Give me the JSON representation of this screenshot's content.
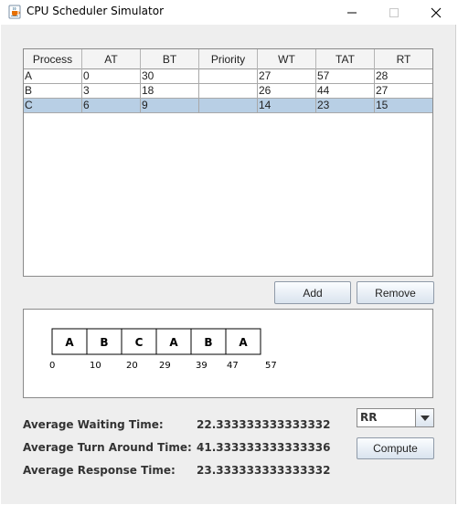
{
  "window": {
    "title": "CPU Scheduler Simulator",
    "icons": {
      "app": "java-coffee-cup-icon",
      "minimize": "minimize-icon",
      "maximize": "maximize-icon",
      "close": "close-icon"
    }
  },
  "table": {
    "columns": [
      "Process",
      "AT",
      "BT",
      "Priority",
      "WT",
      "TAT",
      "RT"
    ],
    "rows": [
      [
        "A",
        "0",
        "30",
        "",
        "27",
        "57",
        "28"
      ],
      [
        "B",
        "3",
        "18",
        "",
        "26",
        "44",
        "27"
      ],
      [
        "C",
        "6",
        "9",
        "",
        "14",
        "23",
        "15"
      ]
    ],
    "selected_row": 2,
    "selection_color": "#b8cfe5"
  },
  "buttons": {
    "add": "Add",
    "remove": "Remove",
    "compute": "Compute"
  },
  "gantt": {
    "blocks": [
      "A",
      "B",
      "C",
      "A",
      "B",
      "A"
    ],
    "times": [
      "0",
      "10",
      "20",
      "29",
      "39",
      "47",
      "57"
    ]
  },
  "stats": {
    "avg_waiting_label": "Average Waiting Time:",
    "avg_waiting_value": "22.333333333333332",
    "avg_turnaround_label": "Average Turn Around Time:",
    "avg_turnaround_value": "41.333333333333336",
    "avg_response_label": "Average Response Time:",
    "avg_response_value": "23.333333333333332"
  },
  "algorithm": {
    "selected": "RR"
  }
}
